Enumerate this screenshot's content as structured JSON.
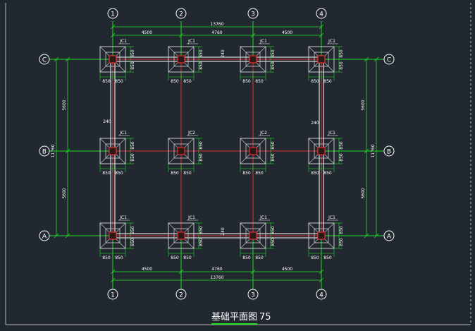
{
  "drawing_title": "基础平面图",
  "drawing_number": "75",
  "axes_x": [
    "①",
    "②",
    "③",
    "④"
  ],
  "axes_y": [
    "Ⓒ",
    "Ⓑ",
    "Ⓐ"
  ],
  "axis_x_labels": [
    "1",
    "2",
    "3",
    "4"
  ],
  "axis_y_labels": [
    "C",
    "B",
    "A"
  ],
  "dim_spans_x": [
    "4500",
    "4760",
    "4500"
  ],
  "dim_total_x": "13760",
  "dim_spans_y_left": [
    "5600",
    "5600"
  ],
  "dim_total_y": "11760",
  "dim_spans_y_right": [
    "5600",
    "5600"
  ],
  "footing_half": "850",
  "beam_width": "240",
  "footings": [
    [
      "JC1",
      "JC1",
      "JC1",
      "JC1"
    ],
    [
      "JC1",
      "JC2",
      "JC2",
      "JC1"
    ],
    [
      "JC1",
      "JC1",
      "JC1",
      "JC1"
    ]
  ],
  "colors": {
    "background": "#212830",
    "dimension": "#22dd22",
    "footing": "#c8c8c8",
    "axis": "#e03030",
    "text": "#ffffff"
  }
}
